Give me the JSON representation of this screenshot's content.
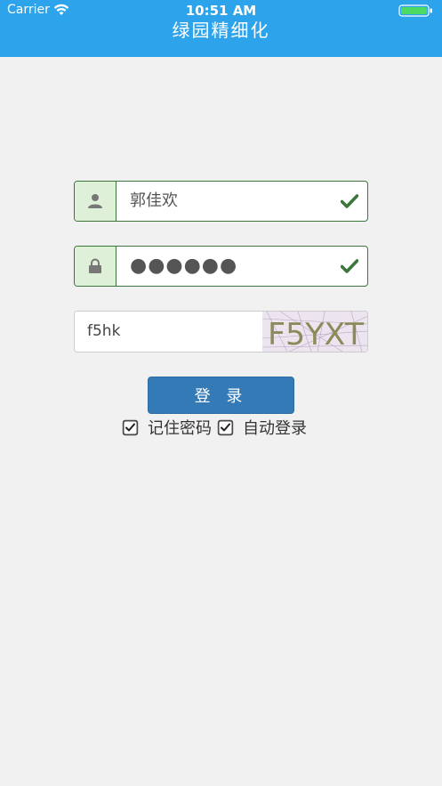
{
  "status_bar": {
    "carrier": "Carrier",
    "time": "10:51 AM",
    "wifi_icon": "wifi-icon",
    "battery_icon": "battery-icon"
  },
  "header": {
    "title": "绿园精细化",
    "background_color": "#2ca3ea"
  },
  "login_form": {
    "username": {
      "value": "郭佳欢",
      "icon": "user-icon",
      "status_icon": "check-icon"
    },
    "password": {
      "value": "●●●●●●",
      "icon": "lock-icon",
      "status_icon": "check-icon"
    },
    "captcha": {
      "input_value": "f5hk",
      "image_text": "F5YXT"
    },
    "login_label": "登 录",
    "remember_password": {
      "label": "记住密码",
      "checked": true
    },
    "auto_login": {
      "label": "自动登录",
      "checked": true
    }
  },
  "colors": {
    "success": "#3c763d",
    "success_bg": "#dff0d8",
    "primary": "#337ab7",
    "page_bg": "#f1f1f1"
  }
}
